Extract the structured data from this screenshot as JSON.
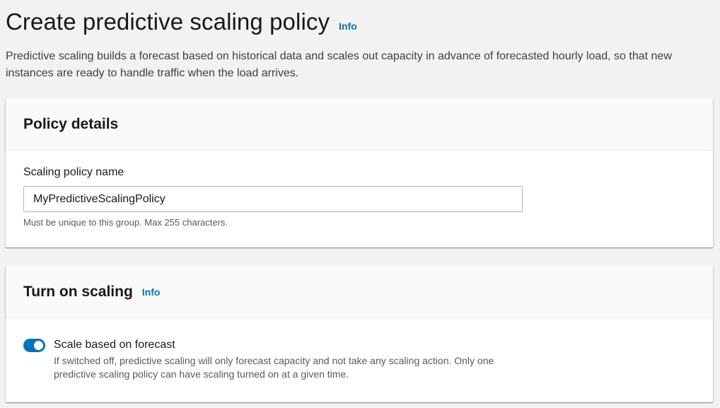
{
  "header": {
    "title": "Create predictive scaling policy",
    "info_label": "Info",
    "description": "Predictive scaling builds a forecast based on historical data and scales out capacity in advance of forecasted hourly load, so that new instances are ready to handle traffic when the load arrives."
  },
  "policy_details": {
    "title": "Policy details",
    "name_label": "Scaling policy name",
    "name_value": "MyPredictiveScalingPolicy",
    "name_hint": "Must be unique to this group. Max 255 characters."
  },
  "turn_on_scaling": {
    "title": "Turn on scaling",
    "info_label": "Info",
    "toggle_label": "Scale based on forecast",
    "toggle_on": true,
    "toggle_description": "If switched off, predictive scaling will only forecast capacity and not take any scaling action. Only one predictive scaling policy can have scaling turned on at a given time."
  },
  "colors": {
    "accent": "#0073bb",
    "background": "#f2f2f2",
    "panel_header": "#fafafa"
  }
}
